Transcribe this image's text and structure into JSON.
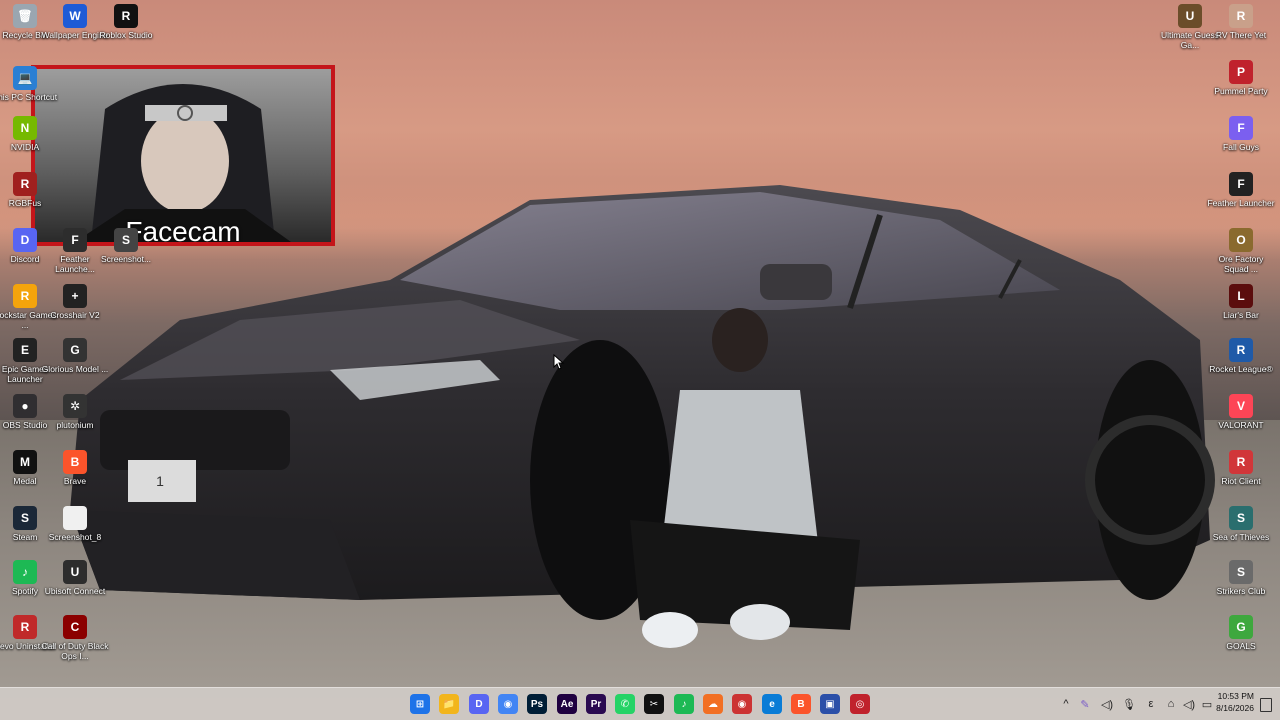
{
  "wallpaper": {
    "facecam_label": "Facecam"
  },
  "left_icons": [
    {
      "label": "Recycle Bin",
      "color": "#9aa6b0",
      "glyph": "🗑"
    },
    {
      "label": "Wallpaper Engine",
      "color": "#1e5bd6",
      "glyph": "W"
    },
    {
      "label": "Roblox Studio",
      "color": "#111111",
      "glyph": "R"
    },
    {
      "label": "This PC Shortcut",
      "color": "#2a7fd4",
      "glyph": "💻"
    },
    {
      "label": "NVIDIA",
      "color": "#76b900",
      "glyph": "N"
    },
    {
      "label": "RGBFus",
      "color": "#a0201e",
      "glyph": "R"
    },
    {
      "label": "Discord",
      "color": "#5865f2",
      "glyph": "D"
    },
    {
      "label": "Feather Launche...",
      "color": "#2d2d2d",
      "glyph": "F"
    },
    {
      "label": "Screenshot...",
      "color": "#444444",
      "glyph": "S"
    },
    {
      "label": "Rockstar Games ...",
      "color": "#f4a40c",
      "glyph": "R"
    },
    {
      "label": "Crosshair V2",
      "color": "#222222",
      "glyph": "+"
    },
    {
      "label": "Epic Games Launcher",
      "color": "#222222",
      "glyph": "E"
    },
    {
      "label": "Glorious Model ...",
      "color": "#333333",
      "glyph": "G"
    },
    {
      "label": "OBS Studio",
      "color": "#302e31",
      "glyph": "●"
    },
    {
      "label": "plutonium",
      "color": "#333333",
      "glyph": "✲"
    },
    {
      "label": "Medal",
      "color": "#111111",
      "glyph": "M"
    },
    {
      "label": "Brave",
      "color": "#fb542b",
      "glyph": "B"
    },
    {
      "label": "Steam",
      "color": "#1b2838",
      "glyph": "S"
    },
    {
      "label": "Screenshot_8",
      "color": "#f0f0f0",
      "glyph": ""
    },
    {
      "label": "Spotify",
      "color": "#1db954",
      "glyph": "♪"
    },
    {
      "label": "Ubisoft Connect",
      "color": "#2d2d2d",
      "glyph": "U"
    },
    {
      "label": "Revo Uninstaller",
      "color": "#c02a2a",
      "glyph": "R"
    },
    {
      "label": "Call of Duty Black Ops I...",
      "color": "#8b0000",
      "glyph": "C"
    }
  ],
  "right_icons": [
    {
      "label": "Ultimate Guess Ga...",
      "color": "#6b4d2a",
      "glyph": "U"
    },
    {
      "label": "RV There Yet",
      "color": "#c9a08a",
      "glyph": "R"
    },
    {
      "label": "Pummel Party",
      "color": "#c0222c",
      "glyph": "P"
    },
    {
      "label": "Fall Guys",
      "color": "#7b5ff0",
      "glyph": "F"
    },
    {
      "label": "Feather Launcher",
      "color": "#222222",
      "glyph": "F"
    },
    {
      "label": "Ore Factory Squad ...",
      "color": "#8a6a2e",
      "glyph": "O"
    },
    {
      "label": "Liar's Bar",
      "color": "#5b0d0d",
      "glyph": "L"
    },
    {
      "label": "Rocket League®",
      "color": "#1f5aa8",
      "glyph": "R"
    },
    {
      "label": "VALORANT",
      "color": "#fd4556",
      "glyph": "V"
    },
    {
      "label": "Riot Client",
      "color": "#d13639",
      "glyph": "R"
    },
    {
      "label": "Sea of Thieves",
      "color": "#2a6e6e",
      "glyph": "S"
    },
    {
      "label": "Strikers Club",
      "color": "#6a6a6a",
      "glyph": "S"
    },
    {
      "label": "GOALS",
      "color": "#3ea83e",
      "glyph": "G"
    }
  ],
  "taskbar": {
    "apps": [
      {
        "name": "start",
        "color": "#1e73e8",
        "glyph": "⊞"
      },
      {
        "name": "file-explorer",
        "color": "#f2b51c",
        "glyph": "📁"
      },
      {
        "name": "discord",
        "color": "#5865f2",
        "glyph": "D"
      },
      {
        "name": "chrome",
        "color": "#4285f4",
        "glyph": "◉"
      },
      {
        "name": "photoshop",
        "color": "#001e36",
        "glyph": "Ps"
      },
      {
        "name": "after-effects",
        "color": "#1f0040",
        "glyph": "Ae"
      },
      {
        "name": "premiere",
        "color": "#2a0a50",
        "glyph": "Pr"
      },
      {
        "name": "whatsapp",
        "color": "#25d366",
        "glyph": "✆"
      },
      {
        "name": "capcut",
        "color": "#111111",
        "glyph": "✂"
      },
      {
        "name": "spotify",
        "color": "#1db954",
        "glyph": "♪"
      },
      {
        "name": "soundcloud",
        "color": "#f26f23",
        "glyph": "☁"
      },
      {
        "name": "chrome-alt",
        "color": "#cc3333",
        "glyph": "◉"
      },
      {
        "name": "edge",
        "color": "#0a7cd6",
        "glyph": "e"
      },
      {
        "name": "brave",
        "color": "#fb542b",
        "glyph": "B"
      },
      {
        "name": "app-blue",
        "color": "#2b4fa8",
        "glyph": "▣"
      },
      {
        "name": "app-red",
        "color": "#c0222c",
        "glyph": "◎"
      }
    ],
    "tray": {
      "expand": "^",
      "network": "⌂",
      "volume": "🔊",
      "mic": "🎙",
      "lang": "ε"
    },
    "time": "10:53 PM",
    "date": "8/16/2026"
  }
}
